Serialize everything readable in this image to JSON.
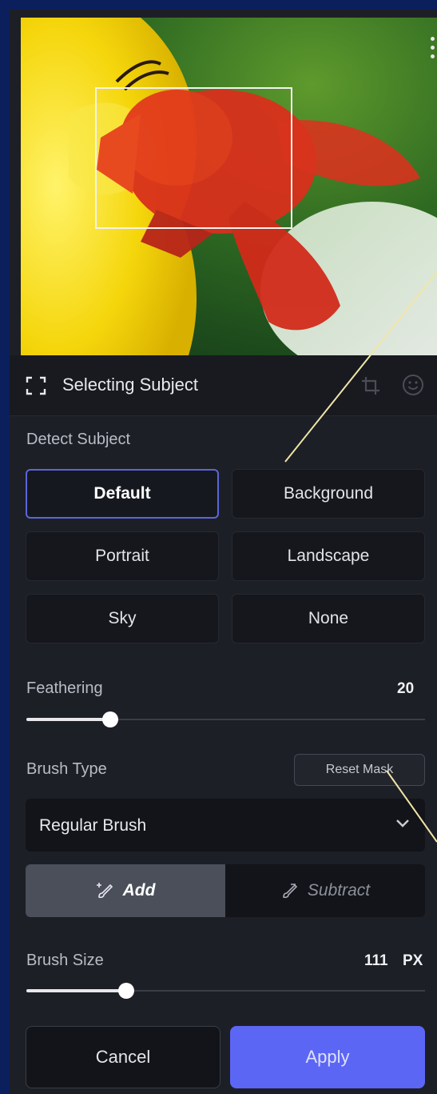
{
  "header": {
    "title": "Selecting Subject"
  },
  "detect": {
    "label": "Detect Subject",
    "options": [
      {
        "label": "Default",
        "selected": true
      },
      {
        "label": "Background",
        "selected": false
      },
      {
        "label": "Portrait",
        "selected": false
      },
      {
        "label": "Landscape",
        "selected": false
      },
      {
        "label": "Sky",
        "selected": false
      },
      {
        "label": "None",
        "selected": false
      }
    ]
  },
  "feathering": {
    "label": "Feathering",
    "value": "20",
    "fraction": 0.21
  },
  "brush": {
    "type_label": "Brush Type",
    "reset_label": "Reset Mask",
    "selected_brush": "Regular Brush",
    "add_label": "Add",
    "subtract_label": "Subtract",
    "size_label": "Brush Size",
    "size_value": "111",
    "size_unit": "PX",
    "size_fraction": 0.25
  },
  "footer": {
    "cancel_label": "Cancel",
    "apply_label": "Apply"
  },
  "colors": {
    "accent": "#5c66f5",
    "active_border": "#5a66d8",
    "mask_overlay": "#e0301e",
    "annotation_line": "#f0e6a8"
  }
}
